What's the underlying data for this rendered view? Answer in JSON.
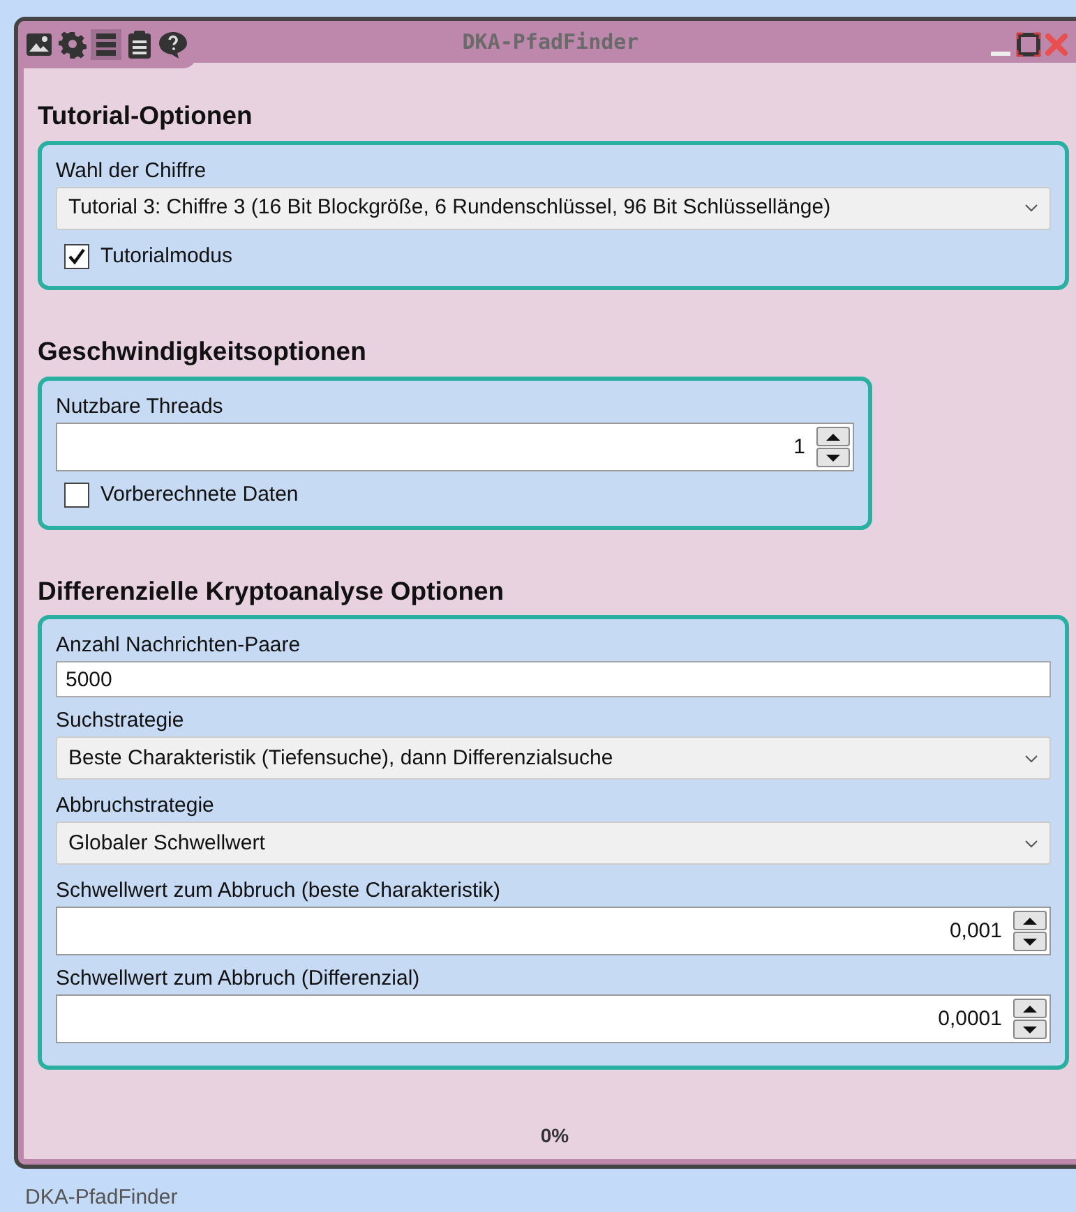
{
  "window": {
    "title": "DKA-PfadFinder",
    "toolbar": [
      {
        "kind": "picture",
        "selected": false
      },
      {
        "kind": "gear",
        "selected": false
      },
      {
        "kind": "list",
        "selected": true
      },
      {
        "kind": "clipboard",
        "selected": false
      },
      {
        "kind": "help",
        "selected": false
      }
    ]
  },
  "sections": [
    {
      "title": "Tutorial-Optionen",
      "fields": [
        {
          "kind": "select",
          "label": "Wahl der Chiffre",
          "value": "Tutorial 3: Chiffre 3 (16 Bit Blockgröße, 6 Rundenschlüssel, 96 Bit Schlüssellänge)"
        },
        {
          "kind": "checkbox",
          "label": "Tutorialmodus",
          "checked": true
        }
      ]
    },
    {
      "title": "Geschwindigkeitsoptionen",
      "fields": [
        {
          "kind": "spin",
          "label": "Nutzbare Threads",
          "value": "1"
        },
        {
          "kind": "checkbox",
          "label": "Vorberechnete Daten",
          "checked": false
        }
      ]
    },
    {
      "title": "Differenzielle Kryptoanalyse Optionen",
      "fields": [
        {
          "kind": "text",
          "label": "Anzahl Nachrichten-Paare",
          "value": "5000"
        },
        {
          "kind": "select",
          "label": "Suchstrategie",
          "value": "Beste Charakteristik (Tiefensuche), dann Differenzialsuche"
        },
        {
          "kind": "select",
          "label": "Abbruchstrategie",
          "value": "Globaler Schwellwert"
        },
        {
          "kind": "spin",
          "label": "Schwellwert zum Abbruch (beste Charakteristik)",
          "value": "0,001"
        },
        {
          "kind": "spin",
          "label": "Schwellwert zum Abbruch (Differenzial)",
          "value": "0,0001"
        }
      ]
    }
  ],
  "progress": {
    "text": "0%"
  },
  "status_bar": "DKA-PfadFinder"
}
